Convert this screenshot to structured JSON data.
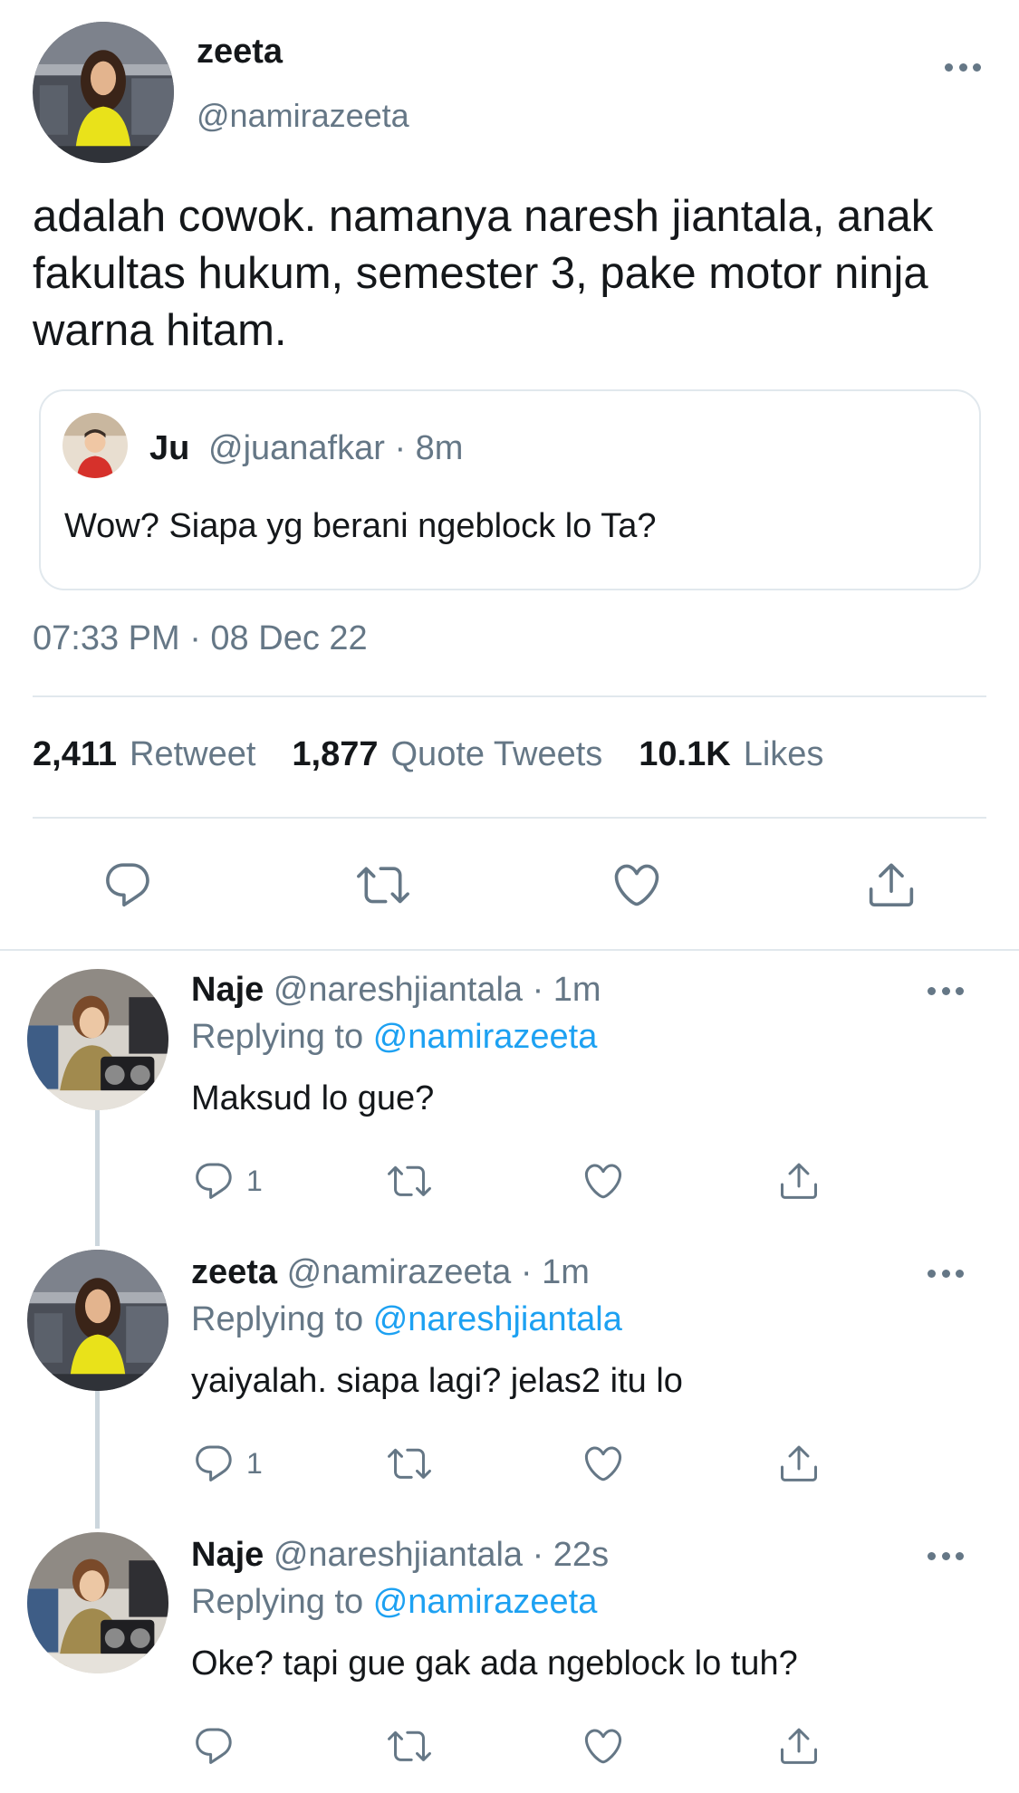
{
  "main_tweet": {
    "author_name": "zeeta",
    "author_handle": "@namirazeeta",
    "text": "adalah cowok. namanya naresh jiantala, anak fakultas hukum, semester 3, pake motor ninja warna hitam.",
    "quote": {
      "author_name": "Ju",
      "author_meta": "@juanafkar · 8m",
      "text": "Wow? Siapa yg berani ngeblock lo Ta?"
    },
    "timestamp": "07:33 PM · 08 Dec 22",
    "stats": {
      "retweets_count": "2,411",
      "retweets_label": "Retweet",
      "quotes_count": "1,877",
      "quotes_label": "Quote Tweets",
      "likes_count": "10.1K",
      "likes_label": "Likes"
    }
  },
  "replies": [
    {
      "author_name": "Naje",
      "author_meta": "@nareshjiantala · 1m",
      "replying_prefix": "Replying to",
      "replying_to": "@namirazeeta",
      "text": "Maksud lo gue?",
      "reply_count": "1"
    },
    {
      "author_name": "zeeta",
      "author_meta": "@namirazeeta · 1m",
      "replying_prefix": "Replying to",
      "replying_to": "@nareshjiantala",
      "text": "yaiyalah. siapa lagi? jelas2 itu lo",
      "reply_count": "1"
    },
    {
      "author_name": "Naje",
      "author_meta": "@nareshjiantala · 22s",
      "replying_prefix": "Replying to",
      "replying_to": "@namirazeeta",
      "text": "Oke? tapi gue gak ada ngeblock lo tuh?",
      "reply_count": ""
    }
  ],
  "icons": {
    "reply": "reply-icon",
    "retweet": "retweet-icon",
    "like": "heart-icon",
    "share": "share-icon",
    "more": "more-icon"
  },
  "colors": {
    "text": "#14171a",
    "secondary": "#657786",
    "link": "#1da1f2",
    "border": "#e1e8ed"
  }
}
